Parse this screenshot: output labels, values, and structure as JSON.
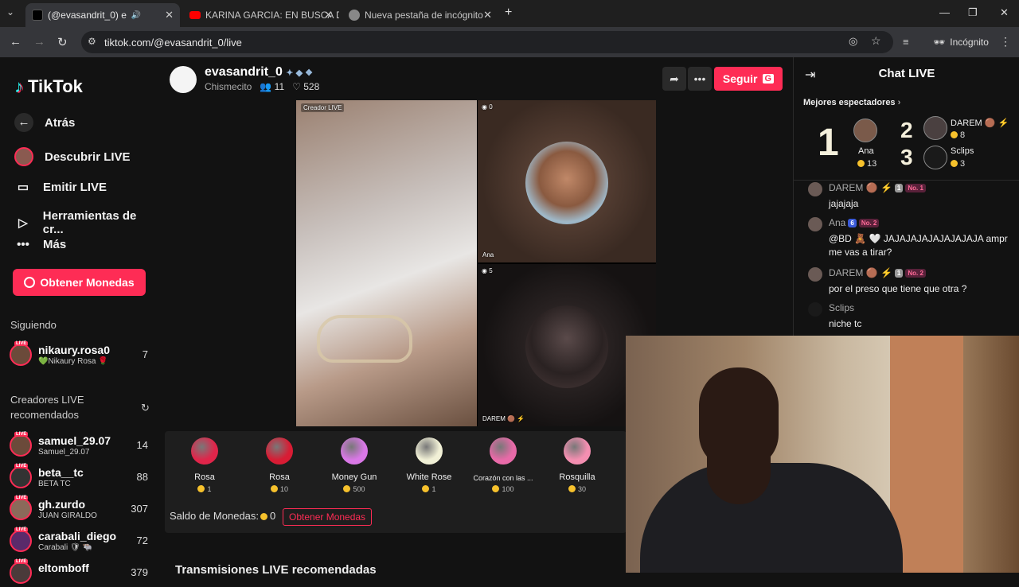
{
  "browser": {
    "tabs": [
      {
        "label": "(@evasandrit_0) e",
        "active": true
      },
      {
        "label": "KARINA GARCIA: EN BUSCA DE",
        "active": false
      },
      {
        "label": "Nueva pestaña de incógnito",
        "active": false
      }
    ],
    "url": "tiktok.com/@evasandrit_0/live",
    "incognito_label": "Incógnito"
  },
  "sidebar": {
    "logo": "TikTok",
    "nav": [
      {
        "label": "Atrás",
        "icon": "arrow-left-icon"
      },
      {
        "label": "Descubrir LIVE",
        "icon": "live-avatar-icon"
      },
      {
        "label": "Emitir LIVE",
        "icon": "video-camera-icon"
      },
      {
        "label": "Herramientas de cr...",
        "icon": "play-square-icon"
      },
      {
        "label": "Más",
        "icon": "ellipsis-icon"
      }
    ],
    "coins_button": "Obtener Monedas",
    "following_title": "Siguiendo",
    "following": [
      {
        "name": "nikaury.rosa0",
        "sub": "💚Nikaury Rosa 🌹",
        "count": "7"
      }
    ],
    "recommended_title": "Creadores LIVE recomendados",
    "recommended": [
      {
        "name": "samuel_29.07",
        "sub": "Samuel_29.07",
        "count": "14"
      },
      {
        "name": "beta__tc",
        "sub": "BETA TC",
        "count": "88"
      },
      {
        "name": "gh.zurdo",
        "sub": "JUAN GIRALDO",
        "count": "307"
      },
      {
        "name": "carabali_diego",
        "sub": "Carabali 🛡 🐃",
        "count": "72"
      },
      {
        "name": "eltomboff",
        "sub": "",
        "count": "379"
      }
    ]
  },
  "stream": {
    "host": "evasandrit_0",
    "category": "Chismecito",
    "viewers": "11",
    "likes": "528",
    "follow_label": "Seguir",
    "follow_key": "G",
    "tile_labels": {
      "creator": "Creador LIVE",
      "guest1": "Ana",
      "guest2": "DAREM 🟤 ⚡",
      "guest1_count": "0",
      "guest2_count": "5"
    }
  },
  "gifts": {
    "items": [
      {
        "name": "Rosa",
        "cost": "1",
        "color": "#e0254a"
      },
      {
        "name": "Rosa",
        "cost": "10",
        "color": "#d81c34"
      },
      {
        "name": "Money Gun",
        "cost": "500",
        "color": "#d978e6"
      },
      {
        "name": "White Rose",
        "cost": "1",
        "color": "#f1f0d6"
      },
      {
        "name": "Corazón con las ...",
        "cost": "100",
        "color": "#e86aa8"
      },
      {
        "name": "Rosquilla",
        "cost": "30",
        "color": "#f48fb1"
      }
    ],
    "balance_label": "Saldo de Monedas:",
    "balance": "0",
    "get_coins": "Obtener Monedas"
  },
  "recommended_section_title": "Transmisiones LIVE recomendadas",
  "chat": {
    "title": "Chat LIVE",
    "top_viewers_title": "Mejores espectadores",
    "top": [
      {
        "rank": "1",
        "name": "Ana",
        "coins": "13"
      },
      {
        "rank": "2",
        "name": "DAREM 🟤 ⚡",
        "coins": "8"
      },
      {
        "rank": "3",
        "name": "Sclips",
        "coins": "3"
      }
    ],
    "messages": [
      {
        "user": "DAREM 🟤 ⚡",
        "badges": [
          "1",
          "No. 1"
        ],
        "text": "jajajaja"
      },
      {
        "user": "Ana",
        "badges": [
          "6",
          "No. 2"
        ],
        "text": "@BD 🧸 🤍 JAJAJAJAJAJAJAJAJA ampr me vas a tirar?"
      },
      {
        "user": "DAREM 🟤 ⚡",
        "badges": [
          "1",
          "No. 2"
        ],
        "text": "por el preso que tiene que otra ?"
      },
      {
        "user": "Sclips",
        "badges": [],
        "text": "niche tc"
      }
    ]
  }
}
